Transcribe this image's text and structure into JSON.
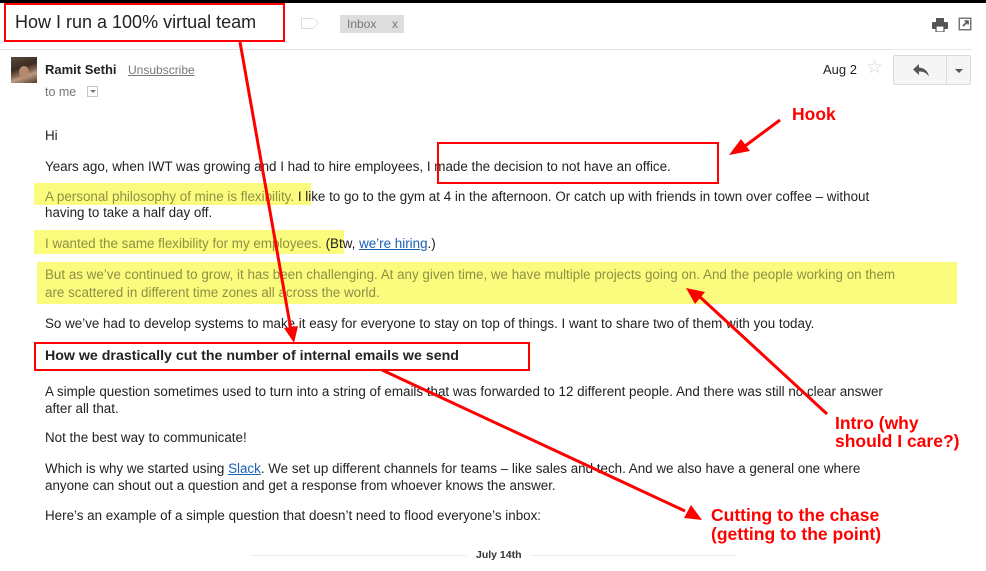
{
  "email": {
    "subject": "How I run a 100% virtual team",
    "label_chip": {
      "text": "Inbox",
      "remove": "x"
    },
    "sender": {
      "name": "Ramit Sethi",
      "unsubscribe": "Unsubscribe",
      "to": "to me"
    },
    "date": "Aug 2",
    "icons": {
      "print": "print-icon",
      "popout": "new-window-icon",
      "star": "star-icon",
      "reply": "reply-icon",
      "more": "chevron-down-icon",
      "label": "label-tag-icon",
      "avatar": "sender-avatar"
    },
    "body": {
      "greeting": "Hi",
      "p1_a": "Years ago, when IWT was growing and I had to hire employees, ",
      "p1_b": "I made the decision to not have an office.",
      "p2_hl": "A personal philosophy of mine is flexibility.",
      "p2_rest": " I like to go to the gym at 4 in the afternoon. Or catch up with friends in town over coffee – without",
      "p2_line2": "having to take a half day off.",
      "p3_hl": "I wanted the same flexibility for my employees.",
      "p3_pre": " (Btw, ",
      "p3_link": "we’re hiring",
      "p3_post": ".)",
      "p4_line1": "But as we’ve continued to grow, it has been challenging. At any given time, we have multiple projects going on. And the people working on them",
      "p4_line2": "are scattered in different time zones all across the world.",
      "p5": "So we’ve had to develop systems to make it easy for everyone to stay on top of things. I want to share two of them with you today.",
      "heading": "How we drastically cut the number of internal emails we send",
      "p6_line1": "A simple question sometimes used to turn into a string of emails that was forwarded to 12 different people. And there was still no clear answer",
      "p6_line2": "after all that.",
      "p7": "Not the best way to communicate!",
      "p8_pre": "Which is why we started using ",
      "p8_link": "Slack",
      "p8_post": ". We set up different channels for teams – like sales and tech. And we also have a general one where",
      "p8_line2": "anyone can shout out a question and get a response from whoever knows the answer.",
      "p9": "Here’s an example of a simple question that doesn’t need to flood everyone’s inbox:",
      "separator_label": "July 14th"
    }
  },
  "annotations": {
    "hook": "Hook",
    "intro_line1": "Intro (why",
    "intro_line2": "should I care?)",
    "chase_line1": "Cutting to the chase",
    "chase_line2": "(getting to the point)",
    "color": "#ff0000"
  },
  "colors": {
    "highlight": "#fbfb7d",
    "link": "#1a5fb4",
    "annotation": "#ff0000"
  }
}
